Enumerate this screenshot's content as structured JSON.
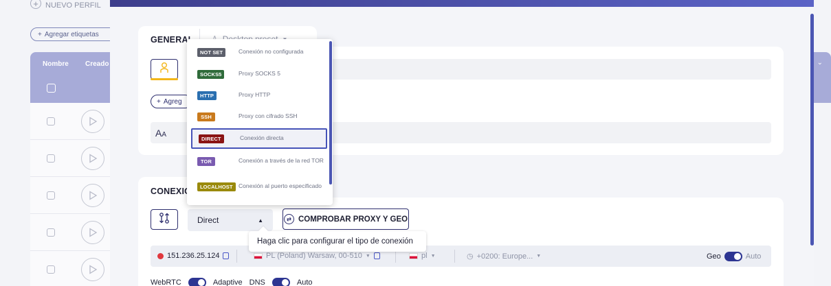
{
  "background": {
    "new_profile_label": "NUEVO PERFIL",
    "add_tags_label": "Agregar etiquetas",
    "table": {
      "columns": [
        "Nombre",
        "Creado"
      ],
      "row_count": 5
    }
  },
  "general": {
    "title": "GENERAL",
    "preset_label": "Desktop preset",
    "add_tag_label": "Agreg"
  },
  "connection": {
    "title": "CONEXIÓ",
    "selected_type": "Direct",
    "check_button_label": "COMPROBAR PROXY Y GEO",
    "tooltip": "Haga clic para configurar el tipo de conexión",
    "ip": "151.236.25.124",
    "location": "PL (Poland) Warsaw, 00-510",
    "language": "pl",
    "timezone": "+0200: Europe...",
    "geo_label": "Geo",
    "geo_mode": "Auto",
    "webrtc_label": "WebRTC",
    "webrtc_mode": "Adaptive",
    "dns_label": "DNS",
    "dns_mode": "Auto"
  },
  "dropdown": {
    "items": [
      {
        "badge": "NOT SET",
        "label": "Conexión no configurada",
        "color": "#5c5f6b"
      },
      {
        "badge": "SOCKS5",
        "label": "Proxy SOCKS 5",
        "color": "#2f6b3a"
      },
      {
        "badge": "HTTP",
        "label": "Proxy HTTP",
        "color": "#2a6fb0"
      },
      {
        "badge": "SSH",
        "label": "Proxy con cifrado SSH",
        "color": "#c97a1c"
      },
      {
        "badge": "DIRECT",
        "label": "Conexión directa",
        "color": "#8a1414"
      },
      {
        "badge": "TOR",
        "label": "Conexión a través de la red TOR",
        "color": "#7a5bb0"
      },
      {
        "badge": "LOCALHOST",
        "label": "Conexión al puerto especificado",
        "color": "#9a8a0c"
      }
    ],
    "selected_index": 4
  },
  "colors": {
    "accent": "#2d2e6e",
    "header": "#a7abd8",
    "scrollbar": "#4b56b3"
  }
}
